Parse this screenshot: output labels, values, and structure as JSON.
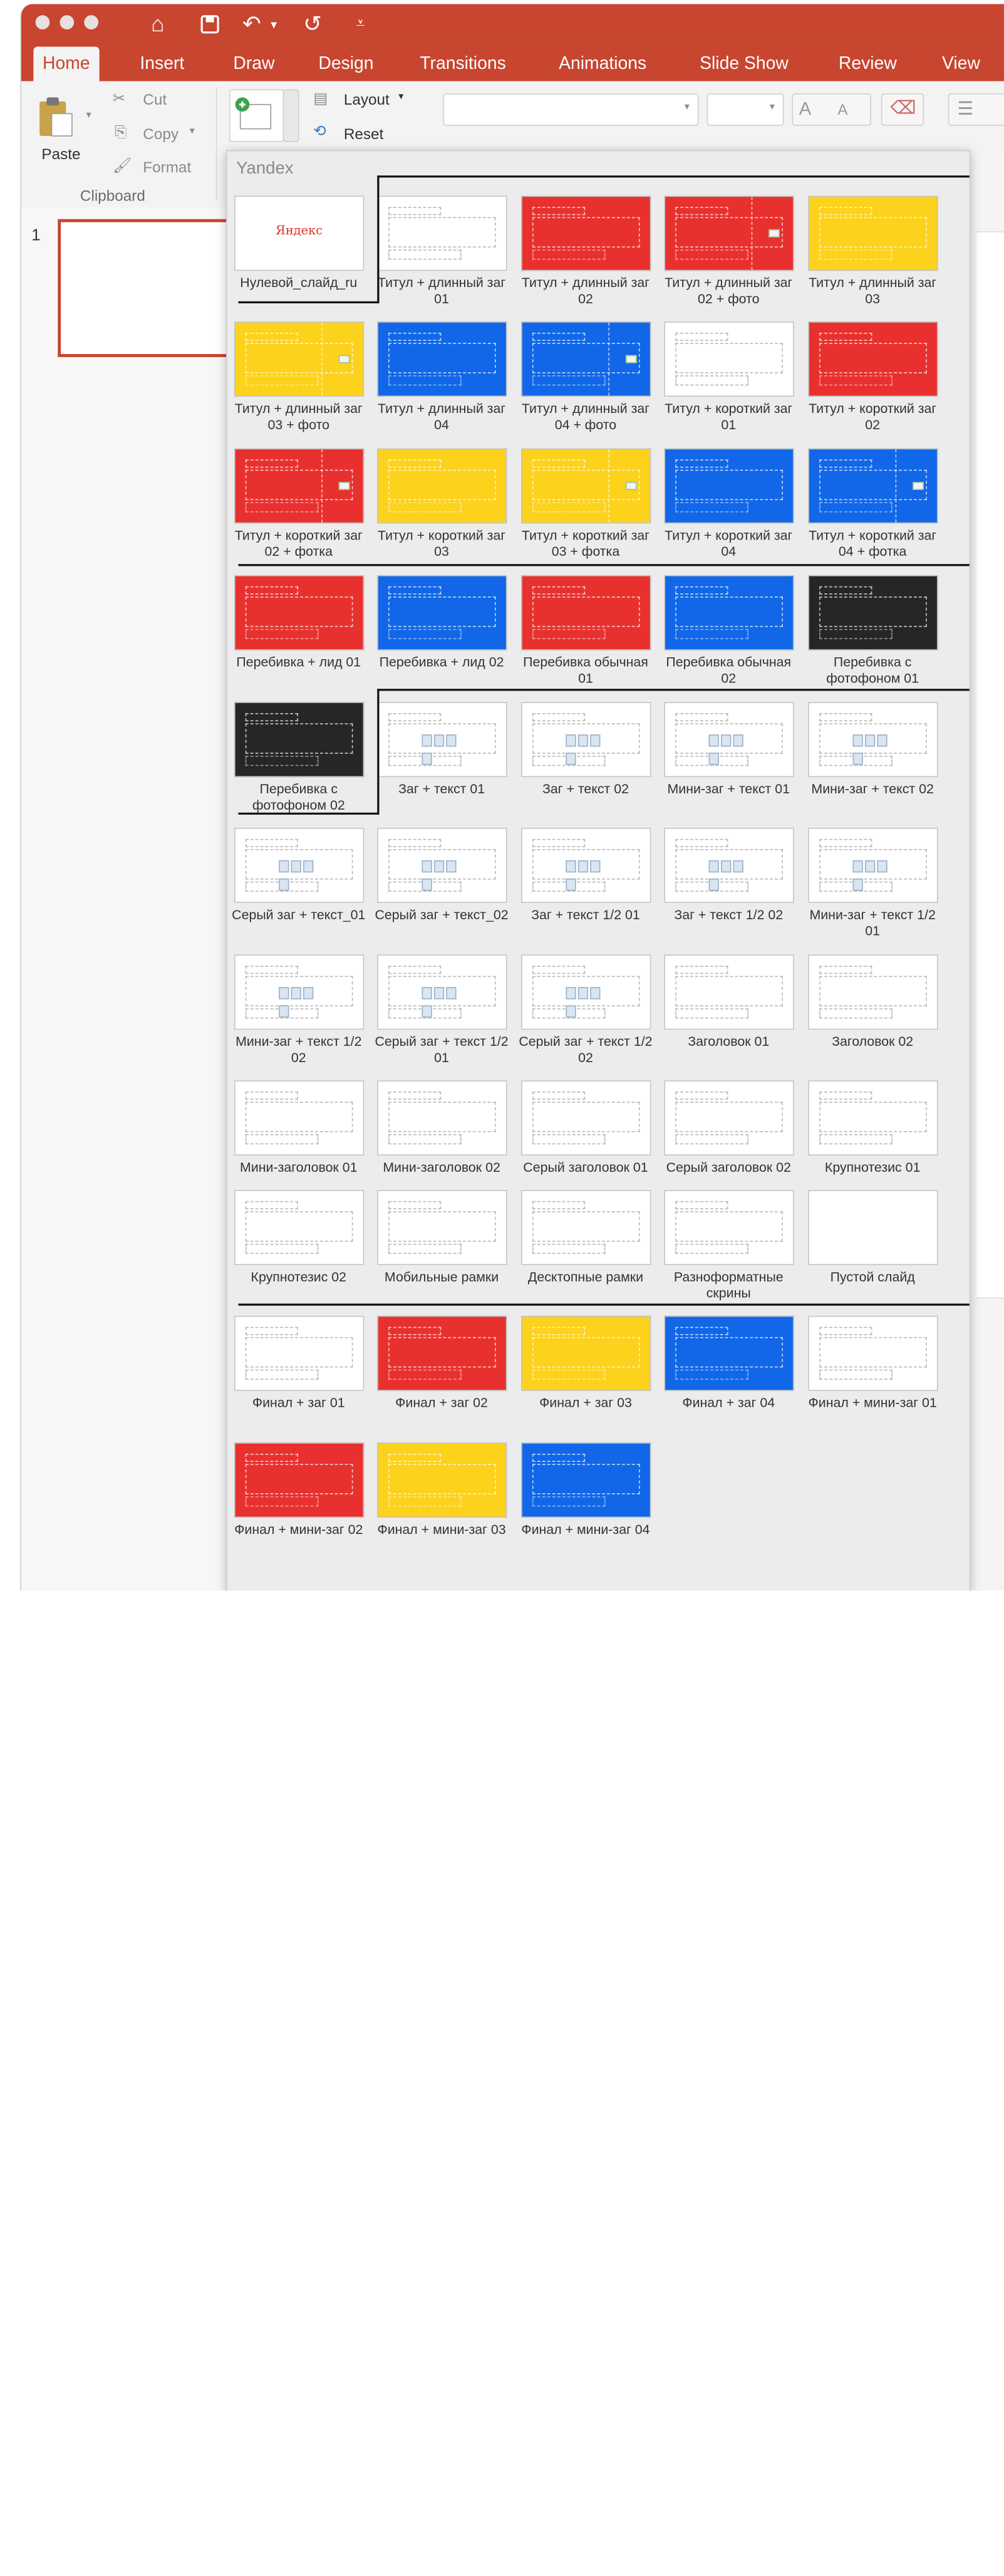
{
  "window": {
    "quick_access": [
      "home-icon",
      "save-icon",
      "undo-icon",
      "redo-icon",
      "customize-icon"
    ]
  },
  "tabs": [
    "Home",
    "Insert",
    "Draw",
    "Design",
    "Transitions",
    "Animations",
    "Slide Show",
    "Review",
    "View"
  ],
  "ribbon": {
    "paste": "Paste",
    "cut": "Cut",
    "copy": "Copy",
    "format": "Format",
    "clipboard_group": "Clipboard",
    "layout": "Layout",
    "reset": "Reset",
    "font_size_up": "A",
    "font_size_down": "A"
  },
  "slides_panel": {
    "slide_number": "1"
  },
  "gallery": {
    "title": "Yandex",
    "items": [
      {
        "label": "Нулевой_слайд_ru",
        "style": "logo",
        "logo": "Яндекс"
      },
      {
        "label": "Титул + длинный заг 01",
        "style": "light"
      },
      {
        "label": "Титул + длинный заг 02",
        "style": "red"
      },
      {
        "label": "Титул + длинный заг 02 + фото",
        "style": "red",
        "photo": true
      },
      {
        "label": "Титул + длинный заг 03",
        "style": "yellow"
      },
      {
        "label": "Титул + длинный заг 03 + фото",
        "style": "yellow",
        "photo": true
      },
      {
        "label": "Титул + длинный заг 04",
        "style": "blue"
      },
      {
        "label": "Титул + длинный заг 04 + фото",
        "style": "blue",
        "photo": true
      },
      {
        "label": "Титул + короткий заг 01",
        "style": "light"
      },
      {
        "label": "Титул + короткий заг 02",
        "style": "red"
      },
      {
        "label": "Титул + короткий заг 02 + фотка",
        "style": "red",
        "photo": true
      },
      {
        "label": "Титул + короткий заг 03",
        "style": "yellow"
      },
      {
        "label": "Титул + короткий заг 03 + фотка",
        "style": "yellow",
        "photo": true
      },
      {
        "label": "Титул + короткий заг 04",
        "style": "blue"
      },
      {
        "label": "Титул + короткий заг 04 + фотка",
        "style": "blue",
        "photo": true
      },
      {
        "label": "Перебивка + лид 01",
        "style": "red"
      },
      {
        "label": "Перебивка + лид 02",
        "style": "blue"
      },
      {
        "label": "Перебивка обычная 01",
        "style": "red"
      },
      {
        "label": "Перебивка обычная 02",
        "style": "blue"
      },
      {
        "label": "Перебивка с фотофоном 01",
        "style": "black"
      },
      {
        "label": "Перебивка с фотофоном 02",
        "style": "black"
      },
      {
        "label": "Заг + текст 01",
        "style": "light",
        "icons": true
      },
      {
        "label": "Заг + текст 02",
        "style": "light",
        "icons": true
      },
      {
        "label": "Мини-заг + текст 01",
        "style": "light",
        "icons": true
      },
      {
        "label": "Мини-заг + текст 02",
        "style": "light",
        "icons": true
      },
      {
        "label": "Серый заг + текст_01",
        "style": "light",
        "icons": true
      },
      {
        "label": "Серый заг + текст_02",
        "style": "light",
        "icons": true
      },
      {
        "label": "Заг + текст 1/2 01",
        "style": "light",
        "icons": true
      },
      {
        "label": "Заг + текст 1/2 02",
        "style": "light",
        "icons": true
      },
      {
        "label": "Мини-заг + текст 1/2 01",
        "style": "light",
        "icons": true
      },
      {
        "label": "Мини-заг + текст 1/2 02",
        "style": "light",
        "icons": true
      },
      {
        "label": "Серый заг + текст 1/2 01",
        "style": "light",
        "icons": true
      },
      {
        "label": "Серый заг + текст 1/2 02",
        "style": "light",
        "icons": true
      },
      {
        "label": "Заголовок 01",
        "style": "light"
      },
      {
        "label": "Заголовок 02",
        "style": "light"
      },
      {
        "label": "Мини-заголовок 01",
        "style": "light"
      },
      {
        "label": "Мини-заголовок 02",
        "style": "light"
      },
      {
        "label": "Серый заголовок 01",
        "style": "light"
      },
      {
        "label": "Серый заголовок 02",
        "style": "light"
      },
      {
        "label": "Крупнотезис 01",
        "style": "light"
      },
      {
        "label": "Крупнотезис 02",
        "style": "light"
      },
      {
        "label": "Мобильные рамки",
        "style": "light"
      },
      {
        "label": "Десктопные рамки",
        "style": "light"
      },
      {
        "label": "Разноформатные скрины",
        "style": "light"
      },
      {
        "label": "Пустой слайд",
        "style": "empty"
      },
      {
        "label": "Финал + заг 01",
        "style": "light"
      },
      {
        "label": "Финал + заг 02",
        "style": "red"
      },
      {
        "label": "Финал + заг 03",
        "style": "yellow"
      },
      {
        "label": "Финал + заг 04",
        "style": "blue"
      },
      {
        "label": "Финал + мини-заг 01",
        "style": "light"
      },
      {
        "label": "Финал + мини-заг 02",
        "style": "red"
      },
      {
        "label": "Финал + мини-заг 03",
        "style": "yellow"
      },
      {
        "label": "Финал + мини-заг 04",
        "style": "blue"
      }
    ]
  }
}
